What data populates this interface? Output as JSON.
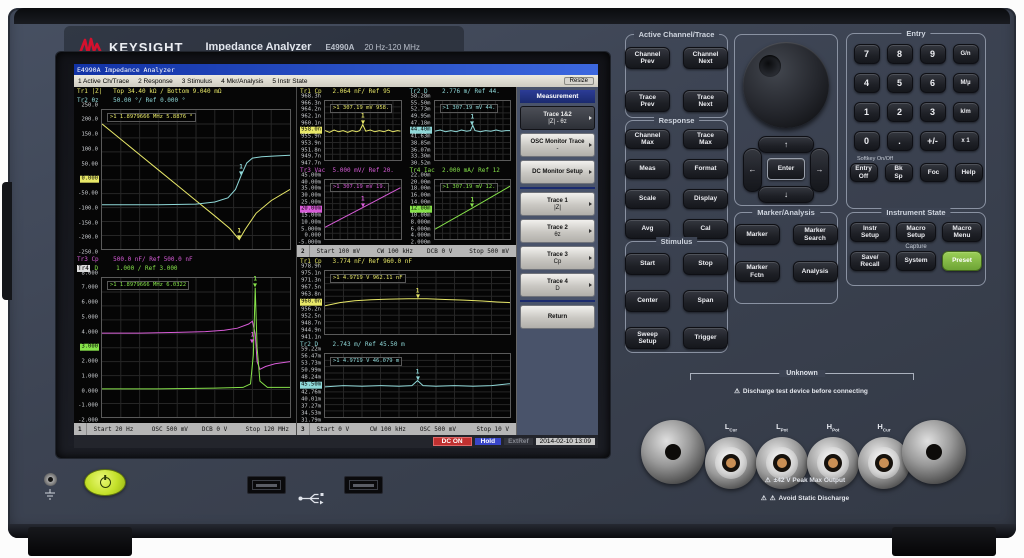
{
  "brand": {
    "name": "KEYSIGHT",
    "product": "Impedance Analyzer",
    "model": "E4990A",
    "range": "20 Hz-120 MHz"
  },
  "screen": {
    "title": "E4990A Impedance Analyzer",
    "menu": [
      "1 Active Ch/Trace",
      "2 Response",
      "3 Stimulus",
      "4 Mkr/Analysis",
      "5 Instr State"
    ],
    "resize_label": "Resize",
    "ch1": {
      "hdr_tr1": "Tr1 |Z|   Top 34.40 kΩ / Bottom 9.040 mΩ",
      "hdr_tr2": "Tr2 θz    50.00 °/ Ref 0.000 °",
      "hdr_tr3": "Tr3 Cp    500.0 nF/ Ref 500.0 nF",
      "tr4_prefix": "Tr4",
      "hdr_tr4_rest": " D     1.000 / Ref 3.000",
      "graph1": {
        "readout": ">1 1.8979666 MHz  5.8876 °",
        "readout_color": "#e8e868",
        "hl": 5,
        "hl_color": "#e8e868",
        "yticks": [
          "250.0",
          "200.0",
          "150.0",
          "100.0",
          "50.00",
          "0.000",
          "-50.00",
          "-100.0",
          "-150.0",
          "-200.0",
          "-250.0"
        ],
        "traces": [
          {
            "color": "#e8e868",
            "points": [
              [
                0,
                0.1
              ],
              [
                0.1,
                0.21
              ],
              [
                0.2,
                0.32
              ],
              [
                0.3,
                0.43
              ],
              [
                0.4,
                0.54
              ],
              [
                0.5,
                0.65
              ],
              [
                0.6,
                0.76
              ],
              [
                0.68,
                0.85
              ],
              [
                0.73,
                0.93
              ],
              [
                0.76,
                0.86
              ],
              [
                0.82,
                0.74
              ],
              [
                0.9,
                0.65
              ],
              [
                1,
                0.57
              ]
            ]
          },
          {
            "color": "#8fd8d8",
            "points": [
              [
                0,
                0.68
              ],
              [
                0.3,
                0.68
              ],
              [
                0.5,
                0.675
              ],
              [
                0.6,
                0.66
              ],
              [
                0.67,
                0.63
              ],
              [
                0.71,
                0.57
              ],
              [
                0.74,
                0.47
              ],
              [
                0.77,
                0.38
              ],
              [
                0.8,
                0.345
              ],
              [
                0.85,
                0.335
              ],
              [
                0.92,
                0.33
              ],
              [
                1,
                0.325
              ]
            ]
          }
        ],
        "markers": [
          {
            "x": 0.73,
            "y": 0.93,
            "label": "1",
            "color": "#e8e868"
          },
          {
            "x": 0.74,
            "y": 0.47,
            "label": "1",
            "color": "#8fd8d8"
          }
        ]
      },
      "graph2": {
        "readout": ">1 1.8979666 MHz  6.0322",
        "readout_color": "#86e24a",
        "hl": 5,
        "hl_color": "#86e24a",
        "yticks": [
          "8.000",
          "7.000",
          "6.000",
          "5.000",
          "4.000",
          "3.000",
          "2.000",
          "1.000",
          "0.000",
          "-1.000",
          "-2.000"
        ],
        "traces": [
          {
            "color": "#d85cd8",
            "points": [
              [
                0,
                0.395
              ],
              [
                0.2,
                0.395
              ],
              [
                0.4,
                0.39
              ],
              [
                0.55,
                0.385
              ],
              [
                0.65,
                0.375
              ],
              [
                0.72,
                0.36
              ],
              [
                0.78,
                0.33
              ],
              [
                0.8,
                0.31
              ],
              [
                0.815,
                0.4
              ],
              [
                0.825,
                0.6
              ],
              [
                0.84,
                0.655
              ],
              [
                0.87,
                0.635
              ],
              [
                0.92,
                0.615
              ],
              [
                1,
                0.6
              ]
            ]
          },
          {
            "color": "#86e24a",
            "points": [
              [
                0,
                0.795
              ],
              [
                0.3,
                0.795
              ],
              [
                0.6,
                0.79
              ],
              [
                0.75,
                0.785
              ],
              [
                0.79,
                0.76
              ],
              [
                0.805,
                0.55
              ],
              [
                0.815,
                0.07
              ],
              [
                0.825,
                0.5
              ],
              [
                0.84,
                0.74
              ],
              [
                0.88,
                0.785
              ],
              [
                1,
                0.785
              ]
            ]
          }
        ],
        "markers": [
          {
            "x": 0.815,
            "y": 0.07,
            "label": "1",
            "color": "#86e24a"
          },
          {
            "x": 0.8,
            "y": 0.47,
            "label": "1",
            "color": "#d85cd8"
          }
        ]
      },
      "status": {
        "ch": "1",
        "start": "Start 20 Hz",
        "mid1": "OSC 500 mV",
        "mid2": "DCB 0 V",
        "stop": "Stop 120 MHz"
      }
    },
    "ch2": {
      "g1": {
        "hdr": "Tr1 Cp   2.064 nF/ Ref 95",
        "hdr_color": "#e8e868",
        "readout": ">1 307.19 mV  958.",
        "readout_color": "#e8e868",
        "hl": 5,
        "hl_color": "#e8e868",
        "yticks": [
          "968.3n",
          "966.3n",
          "964.2n",
          "962.1n",
          "960.1n",
          "958.0n",
          "955.9n",
          "953.9n",
          "951.8n",
          "949.7n",
          "947.7n"
        ],
        "traces": [
          {
            "color": "#e8e868",
            "points": [
              [
                0,
                0.5
              ],
              [
                0.06,
                0.53
              ],
              [
                0.12,
                0.49
              ],
              [
                0.18,
                0.52
              ],
              [
                0.24,
                0.5
              ],
              [
                0.3,
                0.53
              ],
              [
                0.36,
                0.5
              ],
              [
                0.42,
                0.52
              ],
              [
                0.46,
                0.5
              ],
              [
                0.5,
                0.4
              ],
              [
                0.54,
                0.51
              ],
              [
                0.6,
                0.49
              ],
              [
                0.66,
                0.52
              ],
              [
                0.72,
                0.5
              ],
              [
                0.78,
                0.52
              ],
              [
                0.84,
                0.49
              ],
              [
                0.9,
                0.52
              ],
              [
                0.96,
                0.5
              ],
              [
                1,
                0.51
              ]
            ]
          }
        ],
        "markers": [
          {
            "x": 0.5,
            "y": 0.4,
            "label": "1",
            "color": "#e8e868"
          }
        ]
      },
      "g2": {
        "hdr": "Tr2 D    2.776 m/ Ref 44.",
        "hdr_color": "#8fd8d8",
        "readout": ">1 307.19 mV  44.",
        "readout_color": "#8fd8d8",
        "hl": 5,
        "hl_color": "#8fd8d8",
        "yticks": [
          "58.28m",
          "55.50m",
          "52.73m",
          "49.95m",
          "47.18m",
          "44.40m",
          "41.63m",
          "38.85m",
          "36.07m",
          "33.30m",
          "30.52m"
        ],
        "traces": [
          {
            "color": "#8fd8d8",
            "points": [
              [
                0,
                0.51
              ],
              [
                0.07,
                0.49
              ],
              [
                0.14,
                0.52
              ],
              [
                0.21,
                0.5
              ],
              [
                0.28,
                0.52
              ],
              [
                0.35,
                0.49
              ],
              [
                0.42,
                0.51
              ],
              [
                0.47,
                0.5
              ],
              [
                0.5,
                0.41
              ],
              [
                0.53,
                0.5
              ],
              [
                0.6,
                0.52
              ],
              [
                0.67,
                0.5
              ],
              [
                0.74,
                0.51
              ],
              [
                0.81,
                0.49
              ],
              [
                0.88,
                0.51
              ],
              [
                0.94,
                0.5
              ],
              [
                1,
                0.5
              ]
            ]
          }
        ],
        "markers": [
          {
            "x": 0.5,
            "y": 0.41,
            "label": "1",
            "color": "#8fd8d8"
          }
        ]
      },
      "g3": {
        "hdr": "Tr3 Vac  5.000 mV/ Ref 20.",
        "hdr_color": "#d85cd8",
        "readout": ">1 307.19 mV  19.",
        "readout_color": "#d85cd8",
        "hl": 5,
        "hl_color": "#d85cd8",
        "yticks": [
          "45.00m",
          "40.00m",
          "35.00m",
          "30.00m",
          "25.00m",
          "20.00m",
          "15.00m",
          "10.00m",
          "5.000m",
          "0.000",
          "-5.000m"
        ],
        "traces": [
          {
            "color": "#d85cd8",
            "points": [
              [
                0,
                0.8
              ],
              [
                0.5,
                0.465
              ],
              [
                1,
                0.13
              ]
            ]
          }
        ],
        "markers": [
          {
            "x": 0.5,
            "y": 0.465,
            "label": "1",
            "color": "#d85cd8"
          }
        ]
      },
      "g4": {
        "hdr": "Tr4 Iac  2.000 mA/ Ref 12",
        "hdr_color": "#86e24a",
        "readout": ">1 307.19 mV  12.",
        "readout_color": "#86e24a",
        "hl": 5,
        "hl_color": "#86e24a",
        "yticks": [
          "22.00m",
          "20.00m",
          "18.00m",
          "16.00m",
          "14.00m",
          "12.00m",
          "10.00m",
          "8.000m",
          "6.000m",
          "4.000m",
          "2.000m"
        ],
        "traces": [
          {
            "color": "#86e24a",
            "points": [
              [
                0,
                0.83
              ],
              [
                0.5,
                0.47
              ],
              [
                1,
                0.1
              ]
            ]
          }
        ],
        "markers": [
          {
            "x": 0.5,
            "y": 0.47,
            "label": "1",
            "color": "#86e24a"
          }
        ]
      },
      "status": {
        "ch": "2",
        "start": "Start 100 mV",
        "mid1": "CW 100 kHz",
        "mid2": "DCB 0 V",
        "stop": "Stop 500 mV"
      }
    },
    "ch3": {
      "g1": {
        "hdr": "Tr1 Cp   3.774 nF/ Ref 960.0 nF",
        "hdr_color": "#e8e868",
        "readout": ">1 4.9719 V  962.11 nF",
        "readout_color": "#e8e868",
        "hl": 5,
        "hl_color": "#e8e868",
        "yticks": [
          "978.9n",
          "975.1n",
          "971.3n",
          "967.5n",
          "963.8n",
          "960.0n",
          "956.2n",
          "952.5n",
          "948.7n",
          "944.9n",
          "941.1n"
        ],
        "traces": [
          {
            "color": "#e8e868",
            "points": [
              [
                0,
                0.55
              ],
              [
                0.08,
                0.5
              ],
              [
                0.16,
                0.47
              ],
              [
                0.25,
                0.455
              ],
              [
                0.35,
                0.445
              ],
              [
                0.45,
                0.44
              ],
              [
                0.55,
                0.44
              ],
              [
                0.65,
                0.45
              ],
              [
                0.75,
                0.46
              ],
              [
                0.85,
                0.475
              ],
              [
                0.93,
                0.49
              ],
              [
                1,
                0.5
              ]
            ]
          }
        ],
        "markers": [
          {
            "x": 0.5,
            "y": 0.44,
            "label": "1",
            "color": "#e8e868"
          }
        ]
      },
      "g2": {
        "hdr": "Tr2 D    2.743 m/ Ref 45.50 m",
        "hdr_color": "#8fd8d8",
        "readout": ">1 4.9719 V  46.079 m",
        "readout_color": "#8fd8d8",
        "hl": 5,
        "hl_color": "#8fd8d8",
        "yticks": [
          "59.22m",
          "56.47m",
          "53.73m",
          "50.99m",
          "48.24m",
          "45.50m",
          "42.76m",
          "40.01m",
          "37.27m",
          "34.53m",
          "31.79m"
        ],
        "traces": [
          {
            "color": "#8fd8d8",
            "points": [
              [
                0,
                0.52
              ],
              [
                0.1,
                0.5
              ],
              [
                0.2,
                0.51
              ],
              [
                0.3,
                0.5
              ],
              [
                0.4,
                0.51
              ],
              [
                0.47,
                0.5
              ],
              [
                0.5,
                0.42
              ],
              [
                0.53,
                0.5
              ],
              [
                0.6,
                0.51
              ],
              [
                0.7,
                0.5
              ],
              [
                0.8,
                0.51
              ],
              [
                0.9,
                0.5
              ],
              [
                1,
                0.47
              ]
            ]
          }
        ],
        "markers": [
          {
            "x": 0.5,
            "y": 0.42,
            "label": "1",
            "color": "#8fd8d8"
          }
        ]
      },
      "status": {
        "ch": "3",
        "start": "Start 0 V",
        "mid1": "CW 100 kHz",
        "mid2": "OSC 500 mV",
        "stop": "Stop 10 V"
      }
    },
    "softkeys": {
      "title": "Measurement",
      "items": [
        {
          "label": "Trace 1&2",
          "value": "|Z| - θz"
        },
        {
          "label": "OSC Monitor Trace",
          "value": "-"
        },
        {
          "label": "DC Monitor Setup",
          "value": ""
        },
        {
          "label": "Trace 1",
          "value": "|Z|"
        },
        {
          "label": "Trace 2",
          "value": "θz"
        },
        {
          "label": "Trace 3",
          "value": "Cp"
        },
        {
          "label": "Trace 4",
          "value": "D"
        },
        {
          "label": "Return",
          "value": ""
        }
      ]
    },
    "statusbar": {
      "dc": "DC ON",
      "hold": "Hold",
      "ext": "ExtRef",
      "datetime": "2014-02-10 13:09"
    }
  },
  "panel": {
    "active": {
      "title": "Active Channel/Trace",
      "buttons": [
        "Channel\nPrev",
        "Channel\nNext",
        "Trace\nPrev",
        "Trace\nNext"
      ]
    },
    "response": {
      "title": "Response",
      "buttons": [
        "Channel\nMax",
        "Trace\nMax",
        "Meas",
        "Format",
        "Scale",
        "Display",
        "Avg",
        "Cal"
      ]
    },
    "stimulus": {
      "title": "Stimulus",
      "buttons": [
        "Start",
        "Stop",
        "Center",
        "Span",
        "Sweep\nSetup",
        "Trigger"
      ]
    },
    "nav": {
      "up": "↑",
      "down": "↓",
      "left": "←",
      "right": "→",
      "enter": "Enter"
    },
    "marker": {
      "title": "Marker/Analysis",
      "buttons": [
        "Marker",
        "Marker\nSearch",
        "Marker\nFctn",
        "Analysis"
      ]
    },
    "entry": {
      "title": "Entry",
      "keys": [
        "7",
        "8",
        "9",
        "G/n",
        "4",
        "5",
        "6",
        "M/µ",
        "1",
        "2",
        "3",
        "k/m",
        "0",
        ".",
        "+/-",
        "x 1"
      ],
      "softkey_label": "Softkey On/Off",
      "bottom": [
        "Entry\nOff",
        "Bk\nSp",
        "Foc",
        "Help"
      ]
    },
    "instr": {
      "title": "Instrument State",
      "capture": "Capture",
      "buttons": [
        "Instr\nSetup",
        "Macro\nSetup",
        "Macro\nMenu",
        "Save/\nRecall",
        "System",
        "Preset"
      ]
    }
  },
  "connectors": {
    "group_label": "Unknown",
    "warning_top": "Discharge test device before connecting",
    "ports": [
      {
        "main": "L",
        "sub": "Cur"
      },
      {
        "main": "L",
        "sub": "Pot"
      },
      {
        "main": "H",
        "sub": "Pot"
      },
      {
        "main": "H",
        "sub": "Cur"
      }
    ],
    "warning1": "±42 V Peak Max Output",
    "warning2": "Avoid Static Discharge"
  },
  "icons": {
    "warning": "⚠"
  }
}
